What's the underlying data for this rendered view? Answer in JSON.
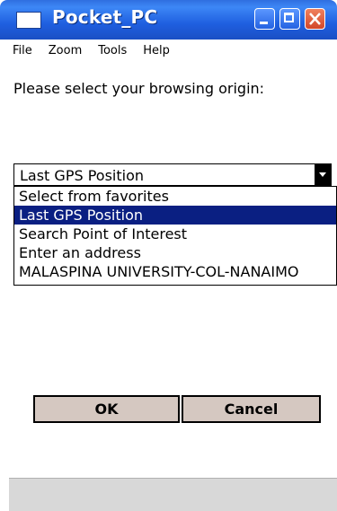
{
  "window": {
    "title": "Pocket_PC"
  },
  "menu": [
    "File",
    "Zoom",
    "Tools",
    "Help"
  ],
  "prompt": "Please select your browsing origin:",
  "combo": {
    "selected": "Last GPS Position",
    "options": [
      "Select from favorites",
      "Last GPS Position",
      "Search Point of Interest",
      "Enter an address",
      "MALASPINA UNIVERSITY-COL-NANAIMO"
    ],
    "highlighted_index": 1
  },
  "buttons": {
    "ok": "OK",
    "cancel": "Cancel"
  },
  "icons": {
    "app": "app-icon",
    "minimize": "minimize-icon",
    "maximize": "maximize-icon",
    "close": "close-icon",
    "dropdown": "chevron-down-icon"
  },
  "colors": {
    "titlebar": "#1f5fe0",
    "selection": "#0a1f82",
    "button_face": "#d5c8c1",
    "close_button": "#d2472a"
  }
}
